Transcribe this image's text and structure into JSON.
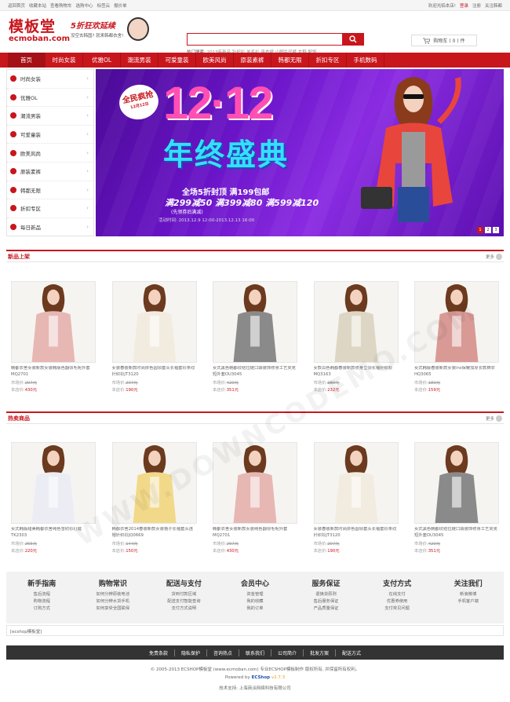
{
  "topbar": {
    "left": [
      "返回首页",
      "收藏本站",
      "查看购物车",
      "选购中心",
      "标签云",
      "报价单"
    ],
    "right": [
      "欢迎光临本店!",
      "登录",
      "注册",
      "关注韩都"
    ]
  },
  "header": {
    "logo_cn": "模板堂",
    "logo_en": "ecmoban.com",
    "slogan_big": "5折狂欢延续",
    "slogan_small": "没空去韩国? 就来韩都衣舍!",
    "search_placeholder": "",
    "search_icon": "search-icon",
    "hot_label": "热门搜索:",
    "hot_words": "2013年新品 针织衫 羊毛衫 连衣裙 小脚牛仔裤 女鞋 配饰",
    "cart_text": "购物车 ( 0 ) 件"
  },
  "nav": [
    "首页",
    "时尚女装",
    "优雅OL",
    "潮流男装",
    "可爱童装",
    "欧美风尚",
    "原装素裤",
    "韩都无限",
    "折扣专区",
    "手机数码"
  ],
  "categories": [
    "时尚女装",
    "优雅OL",
    "潮流男装",
    "可爱童装",
    "欧美风尚",
    "原装素裤",
    "韩都无限",
    "折扣专区",
    "每日新品"
  ],
  "banner": {
    "sticker": "全民疯抢",
    "sticker_sub": "12月12日",
    "date": "12·12",
    "headline": "年终盛典",
    "promo1": "全场5折封顶 满199包邮",
    "promo2": "满299减50 满399减80 满599减120",
    "promo3": "(先领券后满减)",
    "promo4": "活动时间: 2013.12.9 12:00-2013.12.13 16:00",
    "slides": [
      "1",
      "2",
      "3"
    ]
  },
  "section_new": {
    "title": "新品上架",
    "more": "更多",
    "products": [
      {
        "name": "韩都衣舍女装新款女装韩版色翻领毛呢外套MQ2701",
        "market_label": "市场价:",
        "market": "297元",
        "shop_label": "本店价:",
        "price": "430元",
        "color": "#e7b7b4"
      },
      {
        "name": "女装春装新款时尚拼色圆领套头长袖套衫条纹针织衫JT3120",
        "market_label": "市场价:",
        "market": "207元",
        "shop_label": "本店价:",
        "price": "190元",
        "color": "#f2ece0"
      },
      {
        "name": "女式黑色韩都纹结拉链口袋装饰修身工艺夹克短外套OU3045",
        "market_label": "市场价:",
        "market": "420元",
        "shop_label": "本店价:",
        "price": "351元",
        "color": "#8a8a8a"
      },
      {
        "name": "女款白色韩都春装新款修身立领长袖针织衫MQ3163",
        "market_label": "市场价:",
        "market": "280元",
        "shop_label": "本店价:",
        "price": "232元",
        "color": "#ded6c4"
      },
      {
        "name": "女式韩版春装新款女装ins保暖加厚长款棉衣HQ3065",
        "market_label": "市场价:",
        "market": "180元",
        "shop_label": "本店价:",
        "price": "159元",
        "color": "#d99a95"
      }
    ]
  },
  "section_hot": {
    "title": "热卖商品",
    "more": "更多",
    "products": [
      {
        "name": "女式韩版甜美韩都衣舍纯色雪纺衫打底TK2303",
        "market_label": "市场价:",
        "market": "265元",
        "shop_label": "本店价:",
        "price": "220元",
        "color": "#ececf4"
      },
      {
        "name": "韩都衣舍2014春装新款女装格子长袖套头连帽针织衫JQ0669",
        "market_label": "市场价:",
        "market": "144元",
        "shop_label": "本店价:",
        "price": "150元",
        "color": "#f2d98a"
      },
      {
        "name": "韩都衣舍女装新款女装纯色翻领毛呢外套MQ2701",
        "market_label": "市场价:",
        "market": "297元",
        "shop_label": "本店价:",
        "price": "430元",
        "color": "#e7b7b4"
      },
      {
        "name": "女装春装新款时尚拼色圆领套头长袖套衫条纹针织衫JT3120",
        "market_label": "市场价:",
        "market": "207元",
        "shop_label": "本店价:",
        "price": "190元",
        "color": "#f2ece0"
      },
      {
        "name": "女式黑色韩都纹结拉链口袋装饰修身工艺夹克短外套OU3045",
        "market_label": "市场价:",
        "market": "420元",
        "shop_label": "本店价:",
        "price": "351元",
        "color": "#8a8a8a"
      }
    ]
  },
  "help": [
    {
      "title": "新手指南",
      "items": [
        "售后流程",
        "购物流程",
        "订购方式"
      ]
    },
    {
      "title": "购物常识",
      "items": [
        "如何分辨原装电池",
        "如何分辨水货手机",
        "如何享受全国联保"
      ]
    },
    {
      "title": "配送与支付",
      "items": [
        "货到付款区域",
        "配送支付智能查询",
        "支付方式说明"
      ]
    },
    {
      "title": "会员中心",
      "items": [
        "资金管理",
        "我的收藏",
        "我的订单"
      ]
    },
    {
      "title": "服务保证",
      "items": [
        "退换货原则",
        "售后服务保证",
        "产品质量保证"
      ]
    },
    {
      "title": "支付方式",
      "items": [
        "在线支付",
        "优惠券使用",
        "支付常见问题"
      ]
    },
    {
      "title": "关注我们",
      "items": [
        "新浪微博",
        "手机客户端"
      ]
    }
  ],
  "links_text": "[ecshop模板堂]",
  "footnav": [
    "免责条款",
    "隐私保护",
    "咨询热点",
    "联系我们",
    "公司简介",
    "批发方案",
    "配送方式"
  ],
  "copyright": "© 2005-2013 ECSHOP模板堂 (www.ecmoban.com) 专业ECSHOP模板制作 版权所有, 并保留所有权利。",
  "powered_by": "Powered by",
  "powered_name": "ECShop",
  "powered_ver": "v2.7.3",
  "support": "技术支持: 上海商派网络科技有限公司",
  "watermark": "WWW.DOWNCODEMO.COM"
}
